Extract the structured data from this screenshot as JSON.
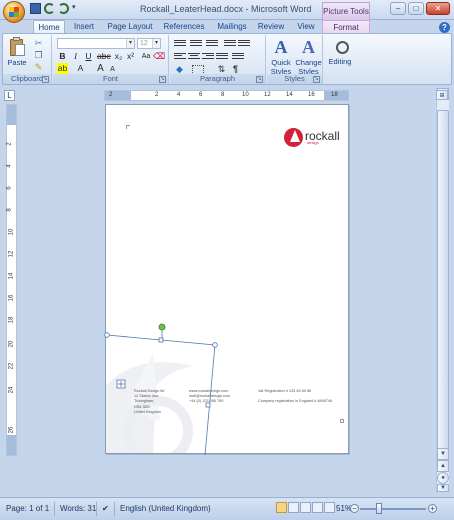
{
  "window": {
    "title": "Rockall_LeaterHead.docx - Microsoft Word",
    "context_tab_group": "Picture Tools",
    "minimize": "–",
    "maximize": "□",
    "close": "✕"
  },
  "tabs": [
    "Home",
    "Insert",
    "Page Layout",
    "References",
    "Mailings",
    "Review",
    "View",
    "Format"
  ],
  "ribbon": {
    "clipboard": {
      "label": "Clipboard",
      "paste": "Paste"
    },
    "font": {
      "label": "Font",
      "font_name": "",
      "font_size": "12",
      "bold": "B",
      "italic": "I",
      "underline": "U",
      "grow": "A",
      "shrink": "A",
      "clear": "Aa",
      "font_color": "A"
    },
    "paragraph": {
      "label": "Paragraph",
      "pilcrow": "¶"
    },
    "styles": {
      "label": "Styles",
      "quick_styles": "Quick Styles",
      "change_styles": "Change Styles"
    },
    "editing": {
      "label": "Editing"
    }
  },
  "ruler": {
    "h_numbers": [
      "2",
      "2",
      "4",
      "6",
      "8",
      "10",
      "12",
      "14",
      "16",
      "18"
    ],
    "v_numbers": [
      "2",
      "4",
      "6",
      "8",
      "10",
      "12",
      "14",
      "16",
      "18",
      "20",
      "22",
      "24",
      "26"
    ]
  },
  "document": {
    "logo_name": "rockall",
    "logo_sub": "design",
    "footer_col1": "Rockall Design ltd\n12 Station Ave,\nTickingham,\nNS6 3DD\nUnited Kingdom",
    "footer_col2": "www.rockalldesign.com\nmail@rockalldesign.com\n+44 (0) 123 456 789",
    "footer_col3": "Vat Registration # 123 45 89 86\n\nCompany registration in England # 4848746"
  },
  "status": {
    "page": "Page: 1 of 1",
    "words": "Words: 31",
    "language": "English (United Kingdom)",
    "zoom": "51%",
    "zoom_fraction": 0.51
  },
  "colors": {
    "brand": "#d1223a",
    "chrome": "#c5d6ec"
  }
}
